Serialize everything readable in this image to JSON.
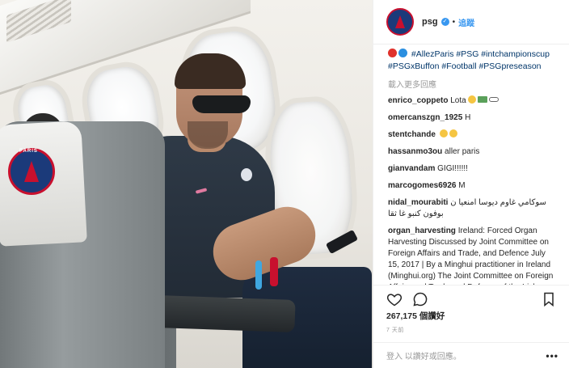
{
  "post": {
    "username": "psg",
    "verified": true,
    "follow_label": "追蹤",
    "caption_emoji": [
      "red-circle",
      "blue-circle"
    ],
    "caption_hashtags": "#AllezParis #PSG #intchampionscup #PSGxBuffon #Football #PSGpreseason",
    "load_more": "載入更多回應",
    "likes": "267,175 個讚好",
    "time": "7 天前",
    "login_text": "登入 以讚好或回應。",
    "login_link": "登入",
    "login_rest": " 以讚好或回應。",
    "more_label": "•••"
  },
  "comments": [
    {
      "user": "enrico_coppeto",
      "text": "Lota",
      "emoji": [
        "face",
        "cash",
        "pill"
      ]
    },
    {
      "user": "omercanszgn_1925",
      "text": "H",
      "emoji": []
    },
    {
      "user": "stentchande",
      "text": "",
      "emoji": [
        "face",
        "face"
      ]
    },
    {
      "user": "hassanmo3ou",
      "text": "aller paris",
      "emoji": []
    },
    {
      "user": "gianvandam",
      "text": "GIGI!!!!!!",
      "emoji": []
    },
    {
      "user": "marcogomes6926",
      "text": "M",
      "emoji": []
    },
    {
      "user": "nidal_mourabiti",
      "text": "سوكامي غاوم ديوسا امنعيا ن بوفون كنبو غا ثقا",
      "emoji": []
    },
    {
      "user": "organ_harvesting",
      "text": "Ireland: Forced Organ Harvesting Discussed by Joint Committee on Foreign Affairs and Trade, and Defence July 15, 2017 | By a Minghui practitioner in Ireland (Minghui.org) The Joint Committee on Foreign Affairs and Trade and Defence of the Irish Parliament discussed the issue",
      "emoji": []
    }
  ],
  "photo": {
    "badge_text": "PARIS"
  }
}
